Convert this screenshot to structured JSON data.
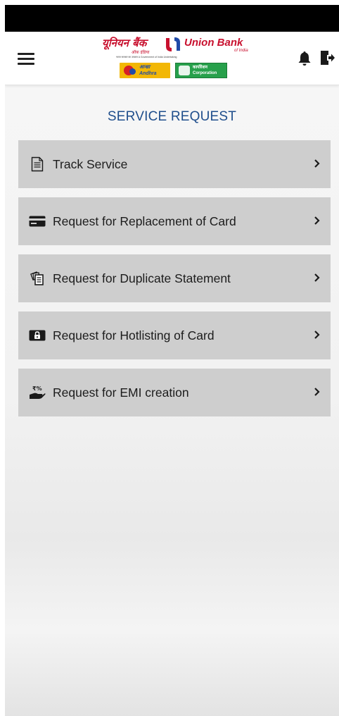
{
  "header": {
    "logo_hindi": "यूनियन बैंक",
    "logo_sub_hindi": "ऑफ़ इंडिया",
    "logo_english": "Union Bank",
    "logo_of_india": "of India",
    "logo_tagline": "भारत सरकार का उपक्रम   A Government of India Undertaking",
    "andhra_badge": "आन्ध्रा\nAndhra",
    "corporation_badge": "कार्पोरेशन\nCorporation",
    "menu_icon": "hamburger-menu-icon",
    "notification_icon": "bell-icon",
    "logout_icon": "logout-icon"
  },
  "page": {
    "title": "SERVICE REQUEST"
  },
  "services": [
    {
      "label": "Track Service",
      "icon": "document-icon"
    },
    {
      "label": "Request for Replacement of Card",
      "icon": "credit-card-icon"
    },
    {
      "label": "Request for Duplicate Statement",
      "icon": "documents-stack-icon"
    },
    {
      "label": "Request for Hotlisting of Card",
      "icon": "locked-card-icon"
    },
    {
      "label": "Request for EMI creation",
      "icon": "emi-hand-icon"
    }
  ],
  "colors": {
    "title": "#1f4e8c",
    "item_background": "#cecece",
    "brand_red": "#c8102e"
  }
}
